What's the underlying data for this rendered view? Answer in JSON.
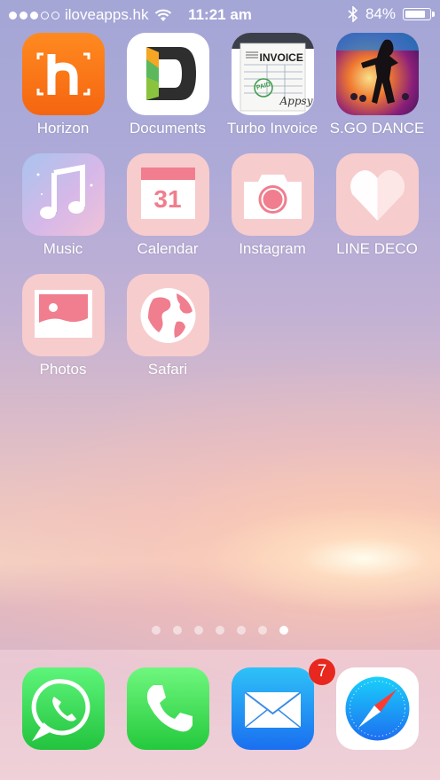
{
  "status_bar": {
    "signal_filled": 3,
    "signal_total": 5,
    "carrier": "iloveapps.hk",
    "time": "11:21 am",
    "battery_percent": "84%",
    "battery_level": 0.84
  },
  "apps": [
    {
      "label": "Horizon"
    },
    {
      "label": "Documents"
    },
    {
      "label": "Turbo Invoice",
      "icon_title": "INVOICE",
      "stamp": "PAID",
      "signature": "Appsy"
    },
    {
      "label": "S.GO DANCE"
    },
    {
      "label": "Music"
    },
    {
      "label": "Calendar",
      "icon_day": "31"
    },
    {
      "label": "Instagram"
    },
    {
      "label": "LINE DECO"
    },
    {
      "label": "Photos"
    },
    {
      "label": "Safari"
    }
  ],
  "page_indicator": {
    "count": 7,
    "active": 7
  },
  "dock": {
    "apps": [
      "whatsapp",
      "phone",
      "mail",
      "safari"
    ],
    "mail_badge": "7"
  },
  "colors": {
    "pink_icon": "#f7cccd",
    "pink_glyph": "#f07e8e",
    "badge": "#e8281f"
  }
}
